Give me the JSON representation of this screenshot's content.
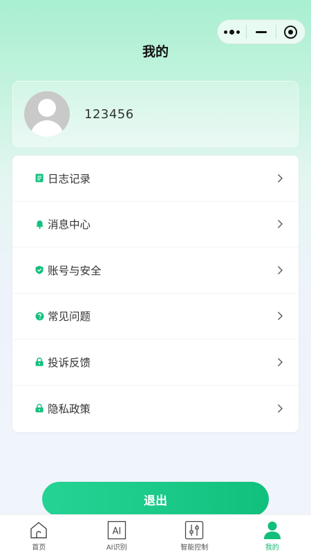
{
  "header": {
    "title": "我的"
  },
  "capsule": {
    "more_icon": "more-dots-icon",
    "minimize_icon": "minimize-icon",
    "close_icon": "target-circle-icon"
  },
  "profile": {
    "username": "123456",
    "avatar_icon": "default-avatar-icon"
  },
  "menu": {
    "items": [
      {
        "label": "日志记录",
        "icon": "log-book-icon"
      },
      {
        "label": "消息中心",
        "icon": "bell-icon"
      },
      {
        "label": "账号与安全",
        "icon": "shield-check-icon"
      },
      {
        "label": "常见问题",
        "icon": "question-circle-icon"
      },
      {
        "label": "投诉反馈",
        "icon": "lock-icon"
      },
      {
        "label": "隐私政策",
        "icon": "lock-icon"
      }
    ]
  },
  "logout_label": "退出",
  "tabbar": {
    "tabs": [
      {
        "label": "首页",
        "icon": "home-icon",
        "active": false
      },
      {
        "label": "AI识别",
        "icon": "ai-icon",
        "active": false
      },
      {
        "label": "智能控制",
        "icon": "sliders-icon",
        "active": false
      },
      {
        "label": "我的",
        "icon": "person-icon",
        "active": true
      }
    ]
  },
  "colors": {
    "accent": "#12c07d",
    "accent_light": "#25d394",
    "background_top": "#a8efd0",
    "background_bottom": "#f1f4fb"
  }
}
